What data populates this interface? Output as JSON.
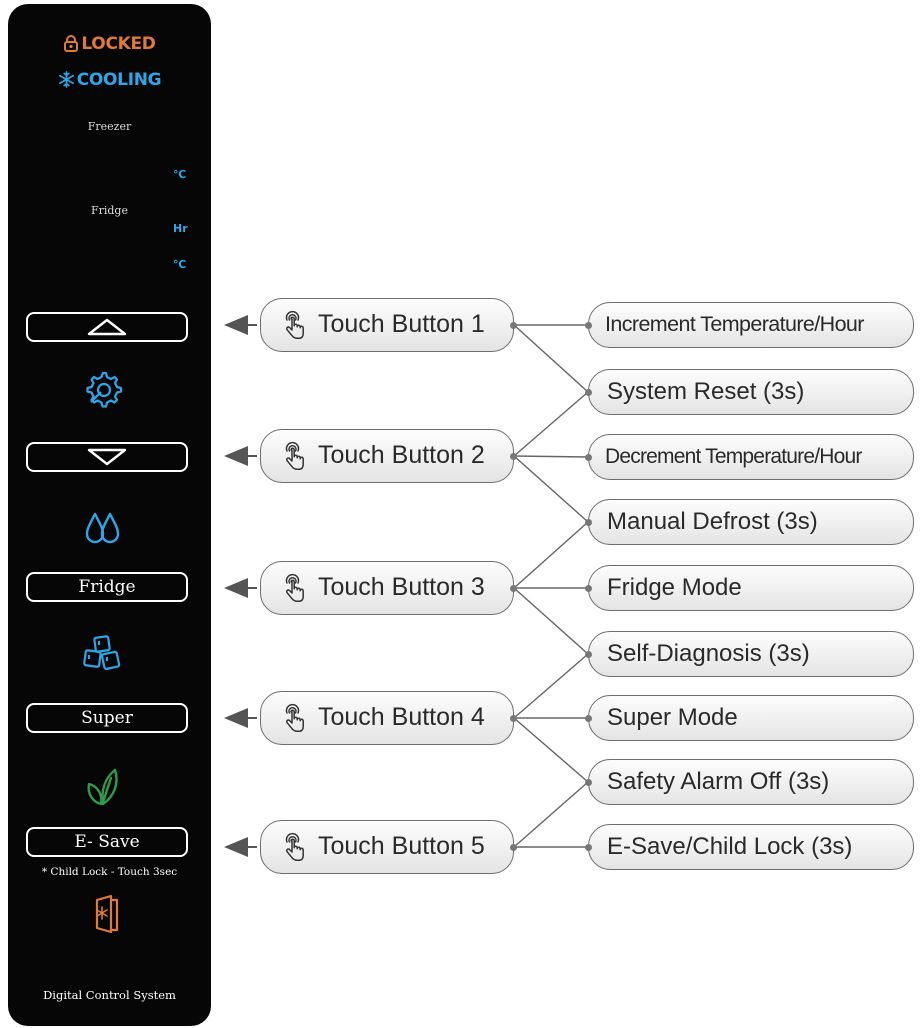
{
  "panel": {
    "status_locked": "LOCKED",
    "status_cooling": "COOLING",
    "zone_freezer": "Freezer",
    "zone_fridge": "Fridge",
    "unit_freezer": "℃",
    "unit_hr": "Hr",
    "unit_fridge": "℃",
    "btn_fridge": "Fridge",
    "btn_super": "Super",
    "btn_esave": "E- Save",
    "child_lock_note": "* Child Lock - Touch 3sec",
    "footer": "Digital Control System"
  },
  "touch_buttons": [
    "Touch Button 1",
    "Touch Button 2",
    "Touch Button 3",
    "Touch Button 4",
    "Touch Button 5"
  ],
  "functions": [
    "Increment Temperature/Hour",
    "System Reset (3s)",
    "Decrement Temperature/Hour",
    "Manual Defrost (3s)",
    "Fridge Mode",
    "Self-Diagnosis (3s)",
    "Super Mode",
    "Safety Alarm Off (3s)",
    "E-Save/Child Lock (3s)"
  ],
  "colors": {
    "panel": "#060606",
    "locked": "#e07a37",
    "cooling": "#2aa7e8",
    "eco": "#2e9b4c",
    "connector": "#666666"
  },
  "icons": [
    "lock-icon",
    "snowflake-icon",
    "arrow-up-icon",
    "settings-wrench-icon",
    "arrow-down-icon",
    "water-drops-icon",
    "ice-cubes-icon",
    "leaf-icon",
    "door-snowflake-icon",
    "touch-hand-icon"
  ]
}
